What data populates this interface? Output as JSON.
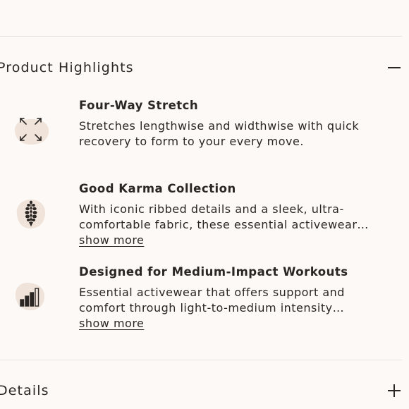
{
  "accordion": {
    "highlights": {
      "title": "Product Highlights",
      "state": "expanded",
      "toggle_icon": "minus-icon"
    },
    "details": {
      "title": "Details",
      "state": "collapsed",
      "toggle_icon": "plus-icon"
    }
  },
  "features": [
    {
      "title": "Four-Way Stretch",
      "icon": "four-way-stretch-icon",
      "description_lines": [
        "Stretches lengthwise and widthwise with quick",
        "recovery to form to your every move."
      ]
    },
    {
      "title": "Good Karma Collection",
      "icon": "good-karma-icon",
      "description_lines": [
        "With iconic ribbed details and a sleek, ultra-",
        "comfortable fabric, these essential activewear…"
      ],
      "show_more_label": "show more"
    },
    {
      "title": "Designed for Medium-Impact Workouts",
      "icon": "medium-impact-icon",
      "description_lines": [
        "Essential activewear that offers support and",
        "comfort through light-to-medium intensity…"
      ],
      "show_more_label": "show more"
    }
  ],
  "colors": {
    "background": "#fcf9f6",
    "icon_blob": "#efe3da",
    "text": "#2a2624",
    "divider": "#e8e2dc"
  }
}
